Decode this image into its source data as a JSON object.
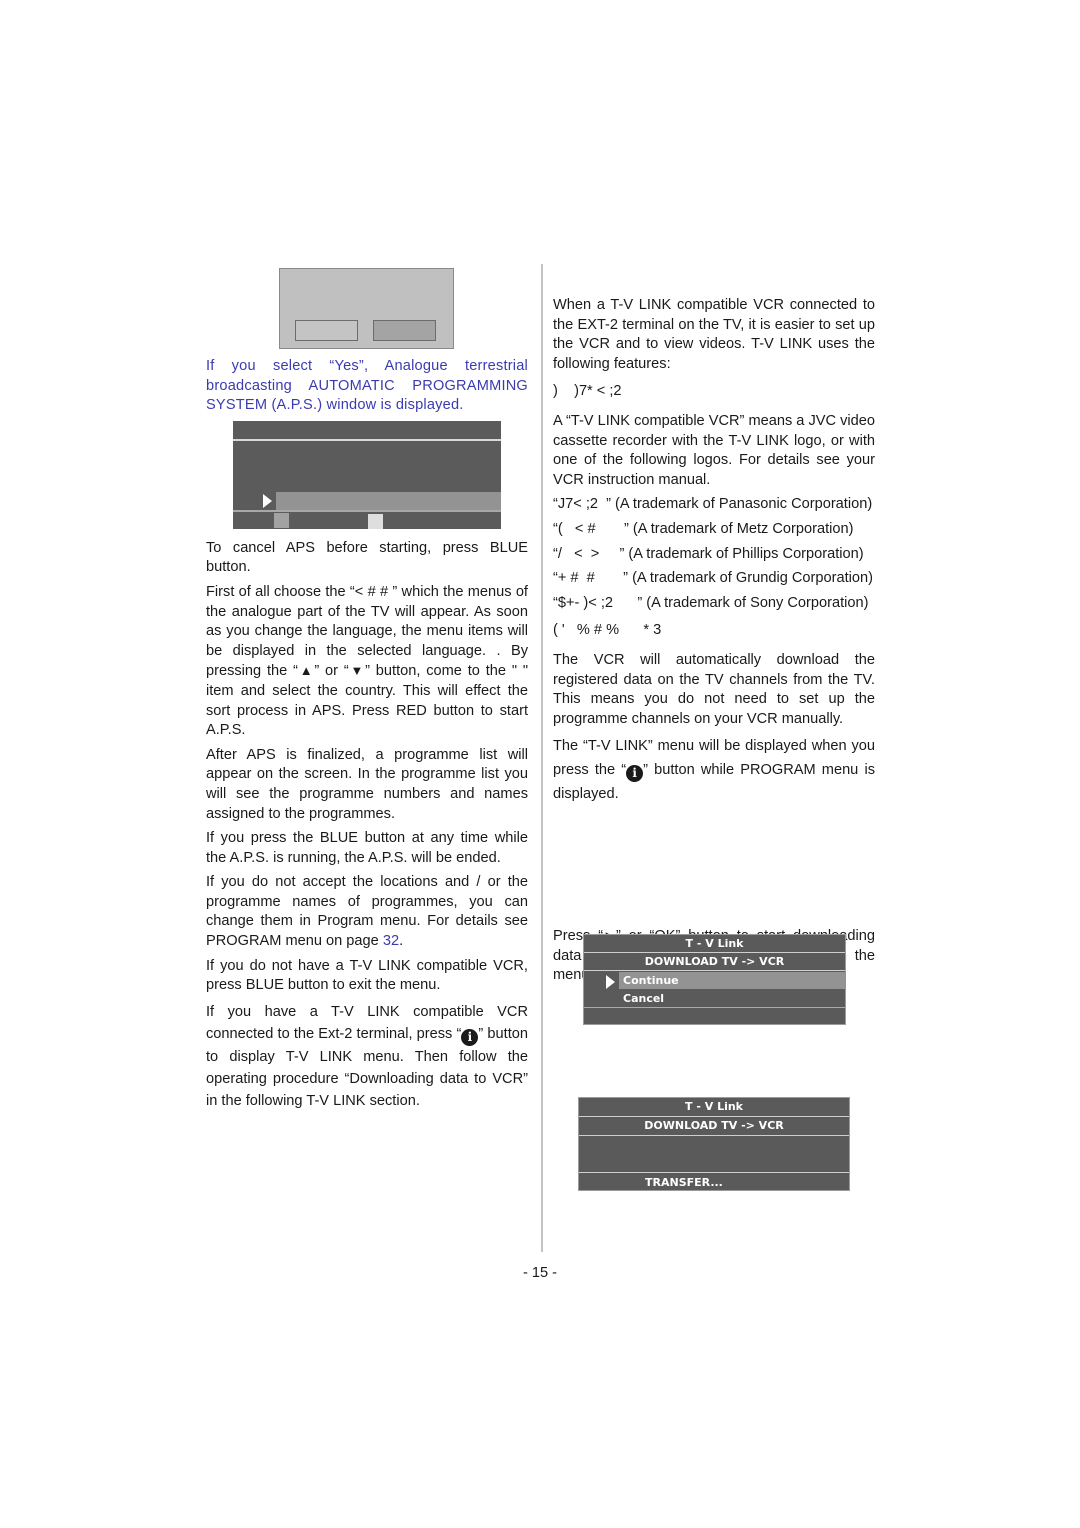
{
  "dialog_confirm": {
    "buttons": [
      "",
      ""
    ]
  },
  "left_column": {
    "intro_blue": "If you select “Yes”, Analogue terrestrial broadcasting AUTOMATIC PROGRAMMING SYSTEM (A.P.S.) window is displayed.",
    "p_cancel": "To cancel APS before starting, press BLUE button.",
    "p_language_a": "First of all choose the “< # #      ” which the menus of the analogue part of the TV will appear. As soon as you change the language, the menu items will be displayed in the selected language. . By pressing the  “",
    "up_icon": "▲",
    "p_language_b": "” or “",
    "down_icon": "▼",
    "p_language_c": "” button, come to the \"            \" item and select the country. This will effect the sort process in APS. Press RED button to start A.P.S.",
    "p_finalized": "After APS is finalized, a programme list will appear on the screen. In the programme list you will see the programme numbers and names assigned to the programmes.",
    "p_blue": "If you press the BLUE button at any time while the A.P.S. is running, the A.P.S. will be ended.",
    "p_accept_a": "If you do not accept the locations and / or the programme names of programmes, you can change them in Program menu. For details see PROGRAM menu on page ",
    "p_accept_link": "32",
    "p_accept_b": ".",
    "p_no_tvlink": "If you do not have a T-V LINK compatible VCR, press BLUE button to exit the menu.",
    "p_tvlink_a": "If you have a T-V LINK compatible VCR connected to the Ext-2 terminal, press  “",
    "info_icon": "i",
    "p_tvlink_b": "” button to display T-V LINK menu. Then follow the operating procedure “Downloading data to VCR” in the following T-V LINK section."
  },
  "right_column": {
    "p_when": "When a T-V LINK compatible VCR connected to the EXT-2 terminal on the TV, it is easier to set up the VCR and to view videos. T-V LINK uses the following features:",
    "garbled_heading_1": ")    )7* < ;2",
    "p_compatible": "A “T-V LINK compatible VCR” means a JVC video cassette recorder with the T-V LINK logo, or with one of the following logos. For details see your VCR instruction manual.",
    "trademarks": [
      "“J7< ;2  ” (A trademark of Panasonic Corporation)",
      "“(   < #       ” (A trademark of Metz Corporation)",
      "“/   <  >     ” (A trademark of Phillips Corporation)",
      "“+ #  #       ” (A trademark of Grundig Corporation)",
      "“$+- )< ;2      ” (A trademark of Sony Corporation)"
    ],
    "garbled_heading_2": "( '   % # %      * 3",
    "p_download": "The VCR will automatically download the registered data on the TV channels from the TV. This means you do not need to set up the programme channels on your VCR manually.",
    "p_menu_a": "The “T-V LINK” menu will be displayed when you press the  “",
    "info_icon": "i",
    "p_menu_b": "” button while PROGRAM menu is displayed.",
    "p_press_a": "Press “",
    "play_icon": "►",
    "p_press_b": "” or “OK” button to start downloading data to VCR. “TRANSFER” is displayed in the menu."
  },
  "menu_tvlink": {
    "title": "T - V Link",
    "subtitle": "DOWNLOAD TV -> VCR",
    "items": [
      "Continue",
      "Cancel"
    ],
    "selected": "Continue"
  },
  "menu_transfer": {
    "title": "T - V Link",
    "subtitle": "DOWNLOAD TV -> VCR",
    "status": "TRANSFER..."
  },
  "page_number": "- 15 -"
}
